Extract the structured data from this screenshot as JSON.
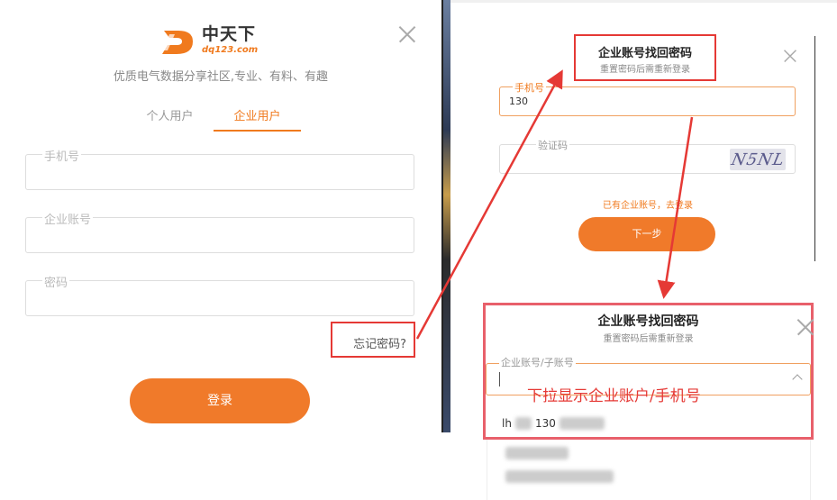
{
  "login": {
    "logo_text": "中天下",
    "logo_url": "dq123.com",
    "tagline": "优质电气数据分享社区,专业、有料、有趣",
    "tabs": [
      {
        "label": "个人用户",
        "active": false
      },
      {
        "label": "企业用户",
        "active": true
      }
    ],
    "fields": {
      "phone_label": "手机号",
      "account_label": "企业账号",
      "password_label": "密码"
    },
    "forgot_label": "忘记密码?",
    "login_button": "登录"
  },
  "recover_step1": {
    "title": "企业账号找回密码",
    "subtitle": "重置密码后需重新登录",
    "phone_label": "手机号",
    "phone_value": "130",
    "captcha_label": "验证码",
    "captcha_text": "N5NL",
    "link_text": "已有企业账号，去登录",
    "next_button": "下一步"
  },
  "recover_step2": {
    "title": "企业账号找回密码",
    "subtitle": "重置密码后需重新登录",
    "account_label": "企业账号/子账号",
    "annotation": "下拉显示企业账户/手机号",
    "option_prefix": "lh",
    "option_num": "130"
  },
  "colors": {
    "accent": "#f07a2a",
    "highlight_red": "#e53935"
  },
  "icons": {
    "close": "close-icon",
    "dropdown": "chevron-up-icon"
  }
}
